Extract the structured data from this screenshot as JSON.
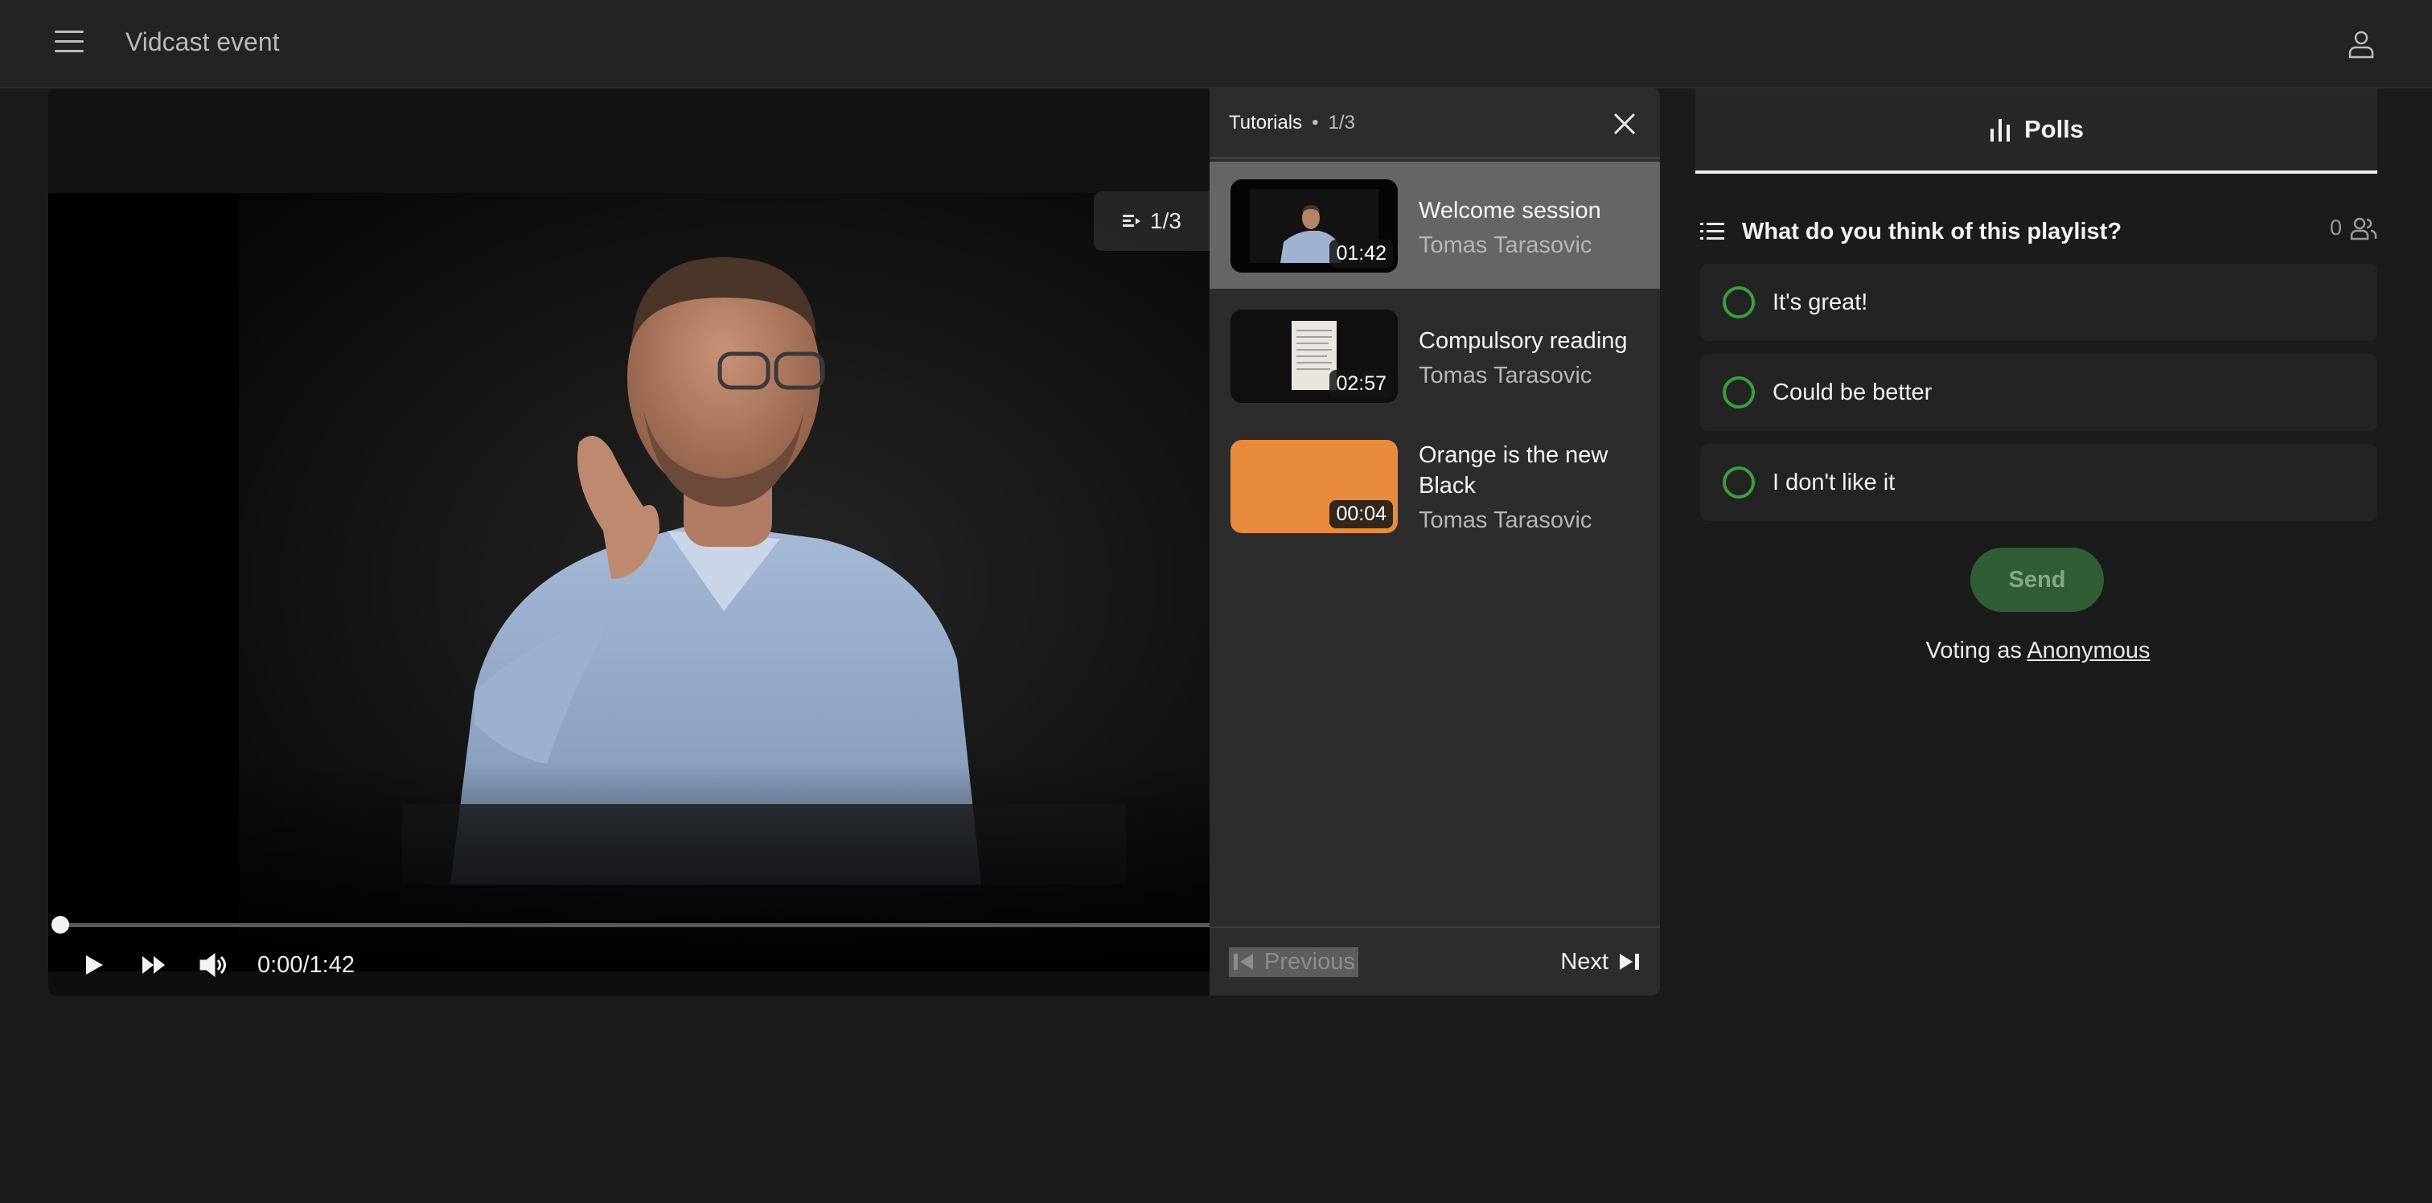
{
  "header": {
    "title": "Vidcast event",
    "menu_icon": "hamburger-icon",
    "user_icon": "user-icon"
  },
  "player": {
    "badge_label": "1/3",
    "current_time": "0:00/1:42",
    "progress": 0.0,
    "controls": [
      "play-icon",
      "fast-forward-icon",
      "volume-icon"
    ]
  },
  "playlist": {
    "title": "Tutorials",
    "separator": "•",
    "position": "1/3",
    "items": [
      {
        "title": "Welcome session",
        "author": "Tomas Tarasovic",
        "duration": "01:42",
        "active": true
      },
      {
        "title": "Compulsory reading",
        "author": "Tomas Tarasovic",
        "duration": "02:57",
        "active": false
      },
      {
        "title": "Orange is the new Black",
        "author": "Tomas Tarasovic",
        "duration": "00:04",
        "active": false
      }
    ],
    "previous_label": "Previous",
    "next_label": "Next"
  },
  "polls": {
    "tab_label": "Polls",
    "question": "What do you think of this playlist?",
    "vote_count": "0",
    "options": [
      "It's great!",
      "Could be better",
      "I don't like it"
    ],
    "send_label": "Send",
    "voting_as_prefix": "Voting as",
    "voting_as_name": "Anonymous"
  },
  "colors": {
    "accent_green": "#3a9e3a",
    "send_bg": "#2f5e35",
    "thumb_orange": "#e88b3d"
  }
}
